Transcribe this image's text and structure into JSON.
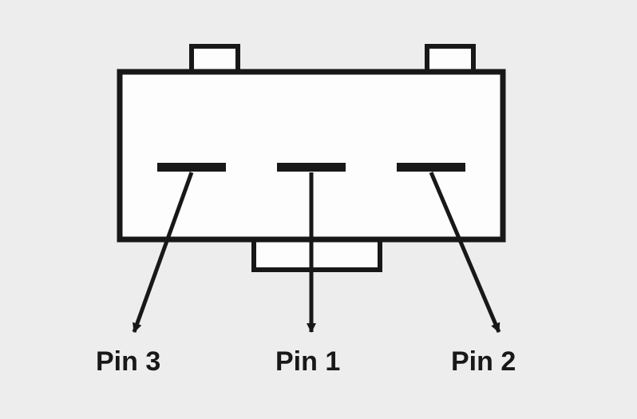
{
  "pins": {
    "left": {
      "label": "Pin 3"
    },
    "center": {
      "label": "Pin 1"
    },
    "right": {
      "label": "Pin 2"
    }
  }
}
